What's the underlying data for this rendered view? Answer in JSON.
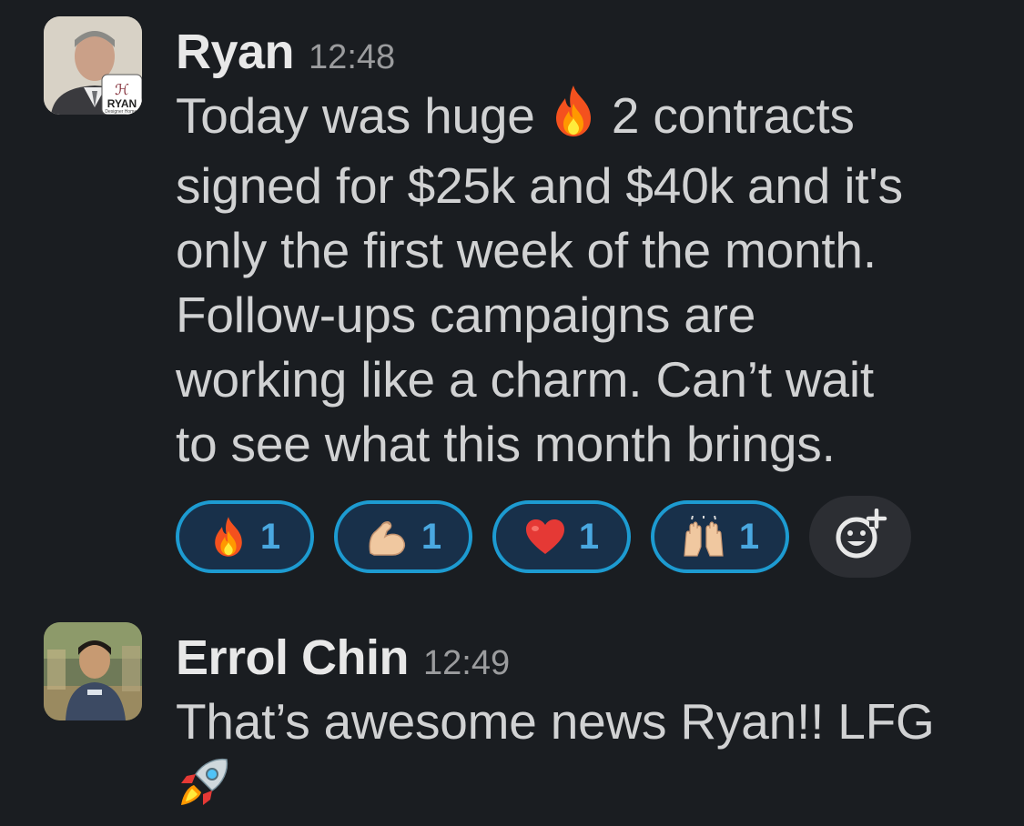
{
  "messages": [
    {
      "sender": "Ryan",
      "time": "12:48",
      "avatar_badge": "RYAN",
      "avatar_badge_sub": "Designer Homes",
      "lines": [
        {
          "before": "Today was huge",
          "emoji": "fire-icon",
          "after": "2 contracts"
        },
        {
          "text": "signed for $25k and $40k and it's"
        },
        {
          "text": "only the first week of the month."
        },
        {
          "text": "Follow-ups campaigns are"
        },
        {
          "text": "working like a charm. Can’t wait"
        },
        {
          "text": "to see what this month brings."
        }
      ],
      "reactions": [
        {
          "icon": "fire-icon",
          "count": "1"
        },
        {
          "icon": "flexed-biceps-icon",
          "count": "1"
        },
        {
          "icon": "red-heart-icon",
          "count": "1"
        },
        {
          "icon": "raising-hands-icon",
          "count": "1"
        }
      ],
      "add_reaction_icon": "add-reaction-icon"
    },
    {
      "sender": "Errol Chin",
      "time": "12:49",
      "lines": [
        {
          "text": "That’s awesome news Ryan!! LFG"
        }
      ],
      "trailing_emoji": "rocket-icon"
    }
  ],
  "colors": {
    "background": "#1a1d21",
    "reaction_border": "#1d9bd1",
    "reaction_count": "#4aa8e0",
    "text": "#d1d2d3"
  }
}
